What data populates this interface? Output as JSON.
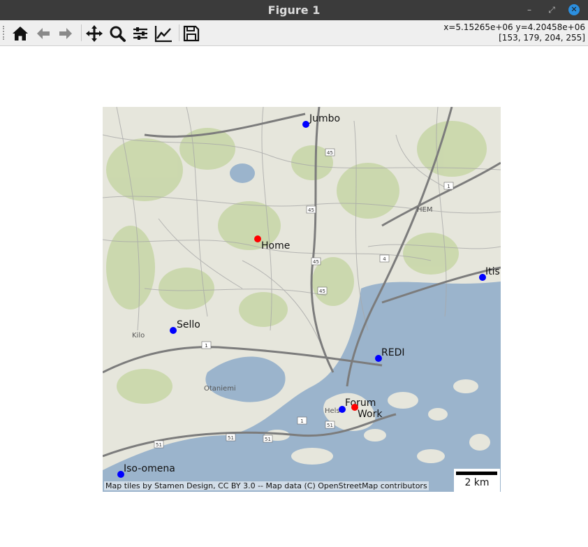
{
  "window": {
    "title": "Figure 1",
    "minimize_glyph": "–",
    "restore_glyph": "⤢",
    "close_glyph": "✕"
  },
  "toolbar": {
    "buttons": [
      {
        "name": "home-button",
        "icon": "home-icon",
        "tooltip": "Reset original view"
      },
      {
        "name": "back-button",
        "icon": "arrow-left-icon",
        "tooltip": "Back to previous view"
      },
      {
        "name": "forward-button",
        "icon": "arrow-right-icon",
        "tooltip": "Forward to next view"
      },
      {
        "name": "pan-button",
        "icon": "move-icon",
        "tooltip": "Pan axes"
      },
      {
        "name": "zoom-button",
        "icon": "magnifier-icon",
        "tooltip": "Zoom to rectangle"
      },
      {
        "name": "subplots-button",
        "icon": "sliders-icon",
        "tooltip": "Configure subplots"
      },
      {
        "name": "customize-button",
        "icon": "line-chart-icon",
        "tooltip": "Edit axis, curve and image parameters"
      },
      {
        "name": "save-button",
        "icon": "floppy-disk-icon",
        "tooltip": "Save the figure"
      }
    ],
    "coords_line1": "x=5.15265e+06 y=4.20458e+06",
    "coords_line2": "[153, 179, 204, 255]"
  },
  "map": {
    "points": [
      {
        "label": "Jumbo",
        "color": "#0000ff"
      },
      {
        "label": "Home",
        "color": "#ff0000"
      },
      {
        "label": "Itis",
        "color": "#0000ff"
      },
      {
        "label": "Sello",
        "color": "#0000ff"
      },
      {
        "label": "REDI",
        "color": "#0000ff"
      },
      {
        "label": "Forum",
        "color": "#0000ff"
      },
      {
        "label": "Work",
        "color": "#ff0000"
      },
      {
        "label": "Iso-omena",
        "color": "#0000ff"
      }
    ],
    "place_labels": [
      "Kilo",
      "Otaniemi",
      "HEM",
      "Hels"
    ],
    "road_numbers": [
      "45",
      "45",
      "45",
      "45",
      "1",
      "1",
      "4",
      "1",
      "51",
      "51",
      "51",
      "51"
    ],
    "attribution": "Map tiles by Stamen Design, CC BY 3.0 -- Map data (C) OpenStreetMap contributors",
    "scalebar_label": "2 km",
    "water_color": "#9bb4cc",
    "land_color": "#e6e6dc",
    "green_color": "#c7d6a6"
  }
}
